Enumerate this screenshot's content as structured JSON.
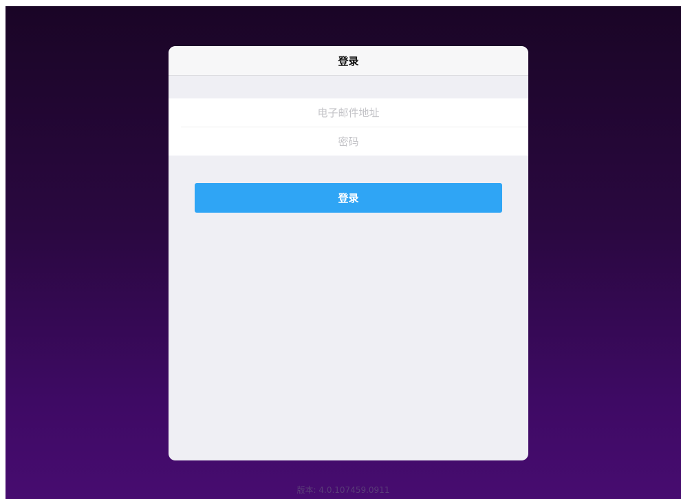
{
  "dialog": {
    "title": "登录",
    "email_placeholder": "电子邮件地址",
    "password_placeholder": "密码",
    "login_button_label": "登录"
  },
  "footer": {
    "version_text": "版本: 4.0.107459.0911"
  },
  "colors": {
    "accent": "#2fa5f5",
    "background_top": "#1a0526",
    "background_bottom": "#470c70",
    "dialog_background": "#efeff4"
  }
}
